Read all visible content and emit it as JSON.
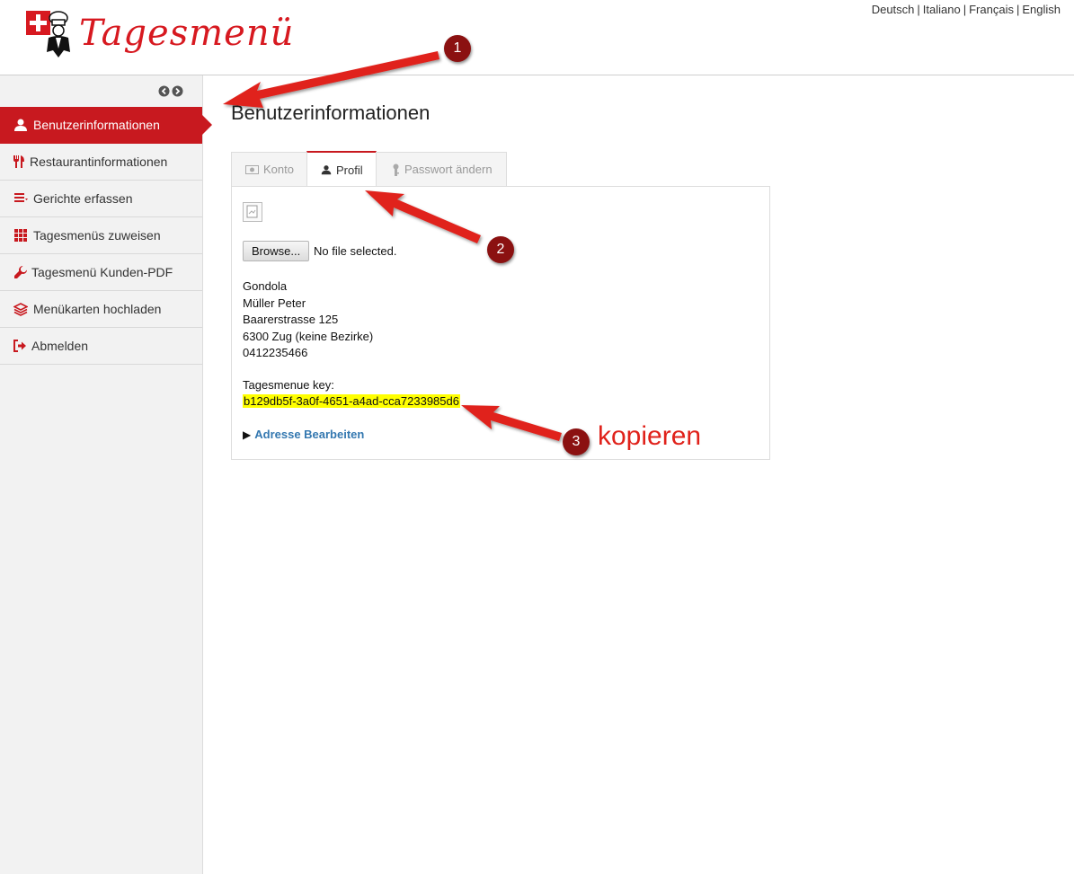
{
  "header": {
    "logo_text": "Tagesmenü",
    "languages": [
      "Deutsch",
      "Italiano",
      "Français",
      "English"
    ]
  },
  "sidebar": {
    "items": [
      {
        "label": "Benutzerinformationen",
        "icon": "user-icon",
        "active": true
      },
      {
        "label": "Restaurantinformationen",
        "icon": "cutlery-icon",
        "active": false
      },
      {
        "label": "Gerichte erfassen",
        "icon": "list-icon",
        "active": false
      },
      {
        "label": "Tagesmenüs zuweisen",
        "icon": "grid-icon",
        "active": false
      },
      {
        "label": "Tagesmenü Kunden-PDF",
        "icon": "wrench-icon",
        "active": false
      },
      {
        "label": "Menükarten hochladen",
        "icon": "layers-icon",
        "active": false
      },
      {
        "label": "Abmelden",
        "icon": "logout-icon",
        "active": false
      }
    ]
  },
  "main": {
    "title": "Benutzerinformationen",
    "tabs": [
      {
        "label": "Konto",
        "icon": "money-icon"
      },
      {
        "label": "Profil",
        "icon": "user-icon",
        "active": true
      },
      {
        "label": "Passwort ändern",
        "icon": "key-icon"
      }
    ],
    "profile": {
      "browse_label": "Browse...",
      "no_file": "No file selected.",
      "address": [
        "Gondola",
        "Müller Peter",
        "Baarerstrasse 125",
        "6300 Zug (keine Bezirke)",
        "0412235466"
      ],
      "key_label": "Tagesmenue key:",
      "key_value": "b129db5f-3a0f-4651-a4ad-cca7233985d6",
      "edit_label": "Adresse Bearbeiten"
    }
  },
  "annotations": {
    "badges": [
      "1",
      "2",
      "3"
    ],
    "note": "kopieren"
  },
  "colors": {
    "brand_red": "#c8191f",
    "arrow_red": "#e0221b",
    "badge": "#8b1111",
    "highlight": "#ffff00",
    "link": "#3478b0"
  }
}
